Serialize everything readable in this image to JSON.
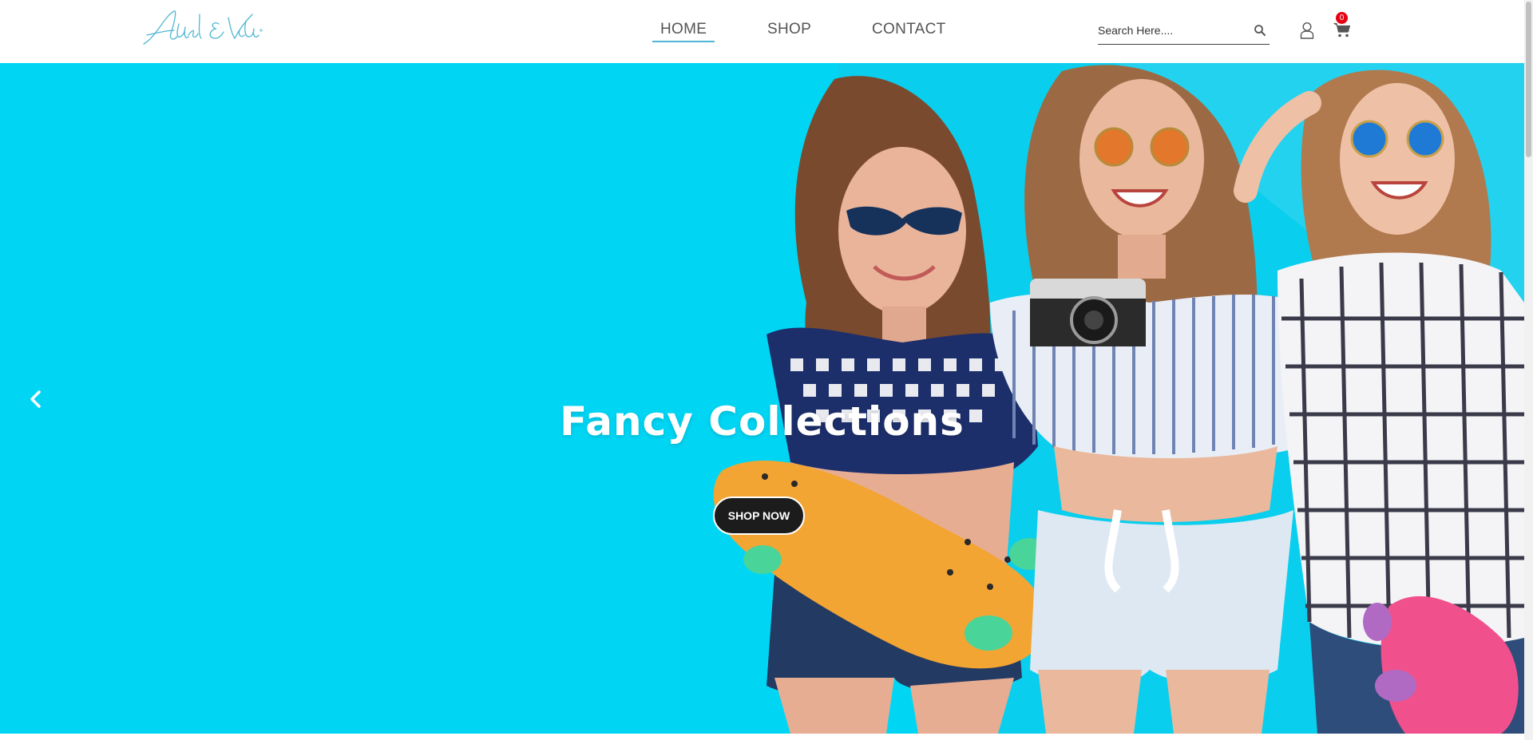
{
  "brand": {
    "logo_text": "Adel & Vida",
    "color": "#4fb6d3"
  },
  "nav": {
    "items": [
      {
        "label": "HOME",
        "active": true
      },
      {
        "label": "SHOP",
        "active": false
      },
      {
        "label": "CONTACT",
        "active": false
      }
    ]
  },
  "search": {
    "placeholder": "Search Here....",
    "icon": "search-icon"
  },
  "account": {
    "icon": "user-icon"
  },
  "cart": {
    "icon": "cart-icon",
    "count": "0",
    "badge_color": "#e60012"
  },
  "hero": {
    "background_color": "#00d6f4",
    "title": "Fancy Collections",
    "button_label": "SHOP NOW",
    "prev_icon": "chevron-left-icon",
    "image": "three young women in sunglasses holding skateboards and a camera"
  }
}
